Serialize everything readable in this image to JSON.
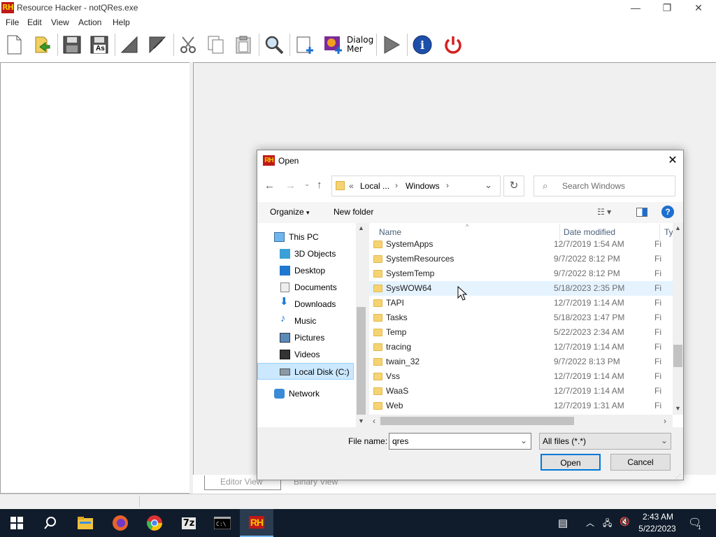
{
  "app": {
    "logo_text": "RH",
    "title": "Resource Hacker - notQRes.exe"
  },
  "window_controls": {
    "minimize": "—",
    "maximize": "❐",
    "close": "✕"
  },
  "menu": [
    "File",
    "Edit",
    "View",
    "Action",
    "Help"
  ],
  "toolbar": {
    "icons": [
      "new-file-icon",
      "open-file-icon",
      "save-icon",
      "save-as-icon",
      "compile-icon",
      "back-icon",
      "cut-icon",
      "copy-icon",
      "paste-icon",
      "find-icon",
      "add-blank-icon",
      "add-image-icon",
      "dialog-merge-icon",
      "run-icon",
      "info-icon",
      "power-icon"
    ],
    "dialog_merge_label_1": "Dialog",
    "dialog_merge_label_2": "Mer",
    "as_label": "As"
  },
  "bottom_tabs": {
    "editor": "Editor View",
    "binary": "Binary View"
  },
  "dialog": {
    "logo_text": "RH",
    "title": "Open",
    "address": {
      "prefix": "«",
      "crumb1": "Local ...",
      "crumb2": "Windows"
    },
    "search_placeholder": "Search Windows",
    "organize": "Organize",
    "new_folder": "New folder",
    "help": "?",
    "nav": [
      {
        "label": "This PC",
        "icon": "this-pc-icon"
      },
      {
        "label": "3D Objects",
        "icon": "3d-objects-icon"
      },
      {
        "label": "Desktop",
        "icon": "desktop-icon"
      },
      {
        "label": "Documents",
        "icon": "documents-icon"
      },
      {
        "label": "Downloads",
        "icon": "downloads-icon"
      },
      {
        "label": "Music",
        "icon": "music-icon"
      },
      {
        "label": "Pictures",
        "icon": "pictures-icon"
      },
      {
        "label": "Videos",
        "icon": "videos-icon"
      },
      {
        "label": "Local Disk (C:)",
        "icon": "local-disk-icon"
      },
      {
        "label": "Network",
        "icon": "network-icon"
      }
    ],
    "columns": {
      "name": "Name",
      "date": "Date modified",
      "type": "Ty"
    },
    "files": [
      {
        "name": "SystemApps",
        "date": "12/7/2019 1:54 AM",
        "type": "Fi"
      },
      {
        "name": "SystemResources",
        "date": "9/7/2022 8:12 PM",
        "type": "Fi"
      },
      {
        "name": "SystemTemp",
        "date": "9/7/2022 8:12 PM",
        "type": "Fi"
      },
      {
        "name": "SysWOW64",
        "date": "5/18/2023 2:35 PM",
        "type": "Fi"
      },
      {
        "name": "TAPI",
        "date": "12/7/2019 1:14 AM",
        "type": "Fi"
      },
      {
        "name": "Tasks",
        "date": "5/18/2023 1:47 PM",
        "type": "Fi"
      },
      {
        "name": "Temp",
        "date": "5/22/2023 2:34 AM",
        "type": "Fi"
      },
      {
        "name": "tracing",
        "date": "12/7/2019 1:14 AM",
        "type": "Fi"
      },
      {
        "name": "twain_32",
        "date": "9/7/2022 8:13 PM",
        "type": "Fi"
      },
      {
        "name": "Vss",
        "date": "12/7/2019 1:14 AM",
        "type": "Fi"
      },
      {
        "name": "WaaS",
        "date": "12/7/2019 1:14 AM",
        "type": "Fi"
      },
      {
        "name": "Web",
        "date": "12/7/2019 1:31 AM",
        "type": "Fi"
      }
    ],
    "file_name_label": "File name:",
    "file_name_value": "qres",
    "file_type": "All files (*.*)",
    "open_button": "Open",
    "cancel_button": "Cancel"
  },
  "taskbar": {
    "apps": [
      "start-icon",
      "search-icon",
      "file-explorer-icon",
      "firefox-icon",
      "chrome-icon",
      "7zip-icon",
      "terminal-icon",
      "resource-hacker-icon"
    ],
    "sevenzip_label": "7z",
    "rh_label": "RH",
    "time": "2:43 AM",
    "date": "5/22/2023",
    "notification_count": "1"
  },
  "colors": {
    "selected_row": "#e5f3ff",
    "nav_selected": "#cce8ff",
    "accent": "#0078d7"
  }
}
